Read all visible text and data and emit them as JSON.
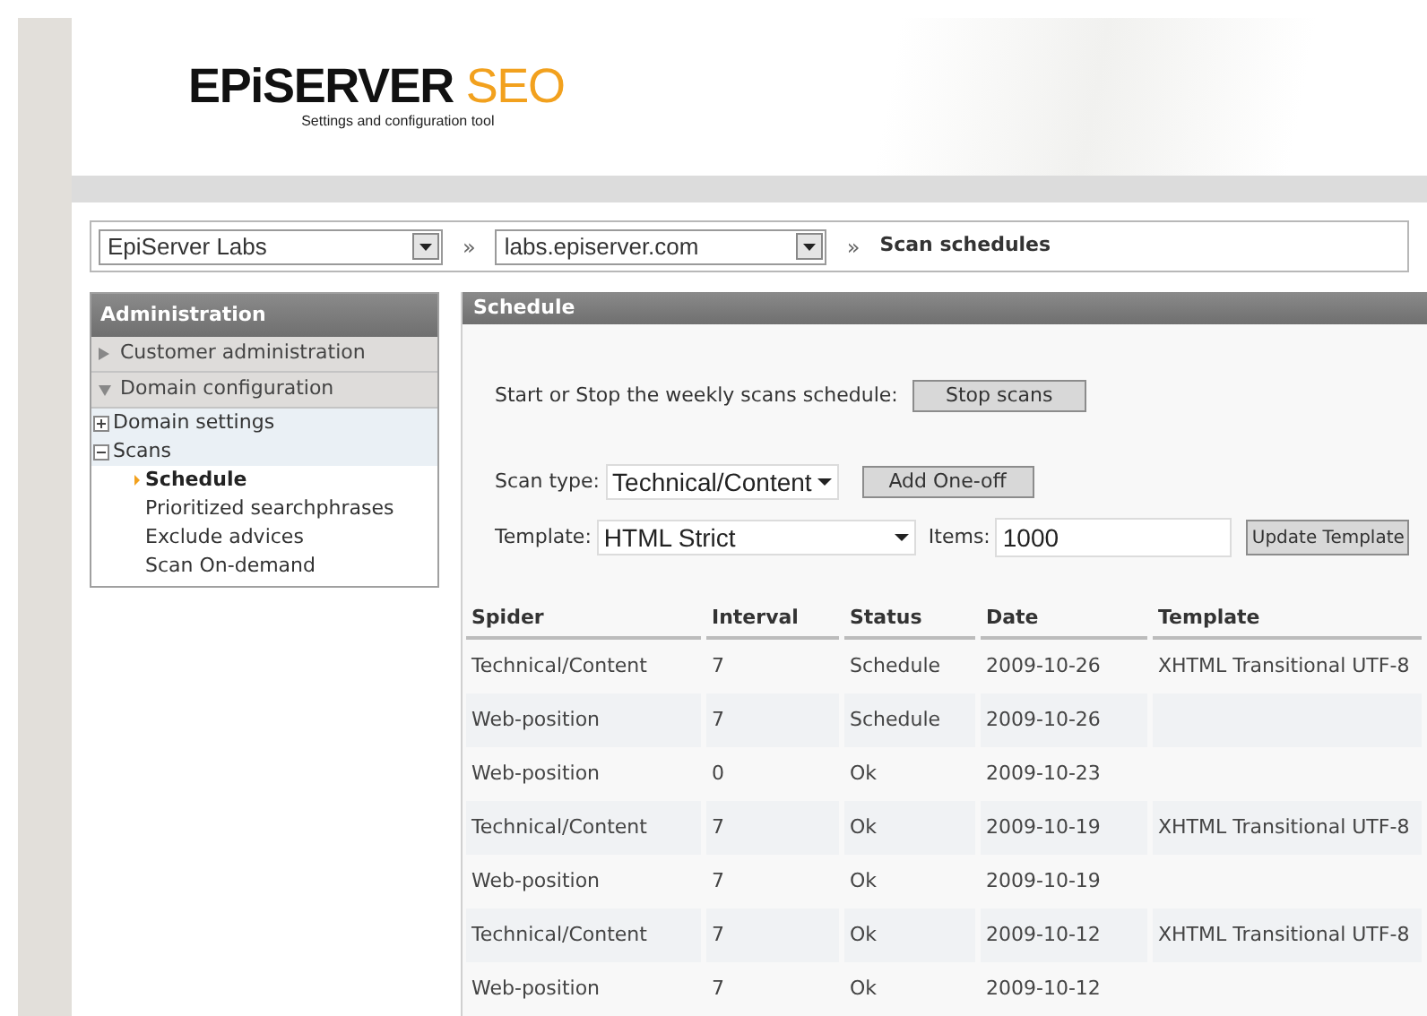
{
  "header": {
    "logo_main": "EPiSERVER",
    "logo_accent": "SEO",
    "tagline": "Settings and configuration tool"
  },
  "breadcrumb": [
    {
      "kind": "select",
      "value": "EpiServer Labs"
    },
    {
      "kind": "separator",
      "text": "»"
    },
    {
      "kind": "select",
      "value": "labs.episerver.com"
    },
    {
      "kind": "separator",
      "text": "»"
    },
    {
      "kind": "current",
      "text": "Scan schedules"
    }
  ],
  "sidebar": {
    "title": "Administration",
    "items": [
      {
        "label": "Customer administration",
        "expanded": false
      },
      {
        "label": "Domain configuration",
        "expanded": true,
        "children": [
          {
            "label": "Domain settings",
            "expanded": false
          },
          {
            "label": "Scans",
            "expanded": true,
            "children": [
              {
                "label": "Schedule",
                "selected": true
              },
              {
                "label": "Prioritized searchphrases",
                "selected": false
              },
              {
                "label": "Exclude advices",
                "selected": false
              },
              {
                "label": "Scan On-demand",
                "selected": false
              }
            ]
          }
        ]
      }
    ]
  },
  "panel": {
    "title": "Schedule",
    "toggle": {
      "label": "Start or Stop the weekly scans schedule:",
      "button": "Stop scans"
    },
    "scan_type": {
      "label": "Scan type:",
      "value": "Technical/Content",
      "button": "Add One-off"
    },
    "template": {
      "label": "Template:",
      "value": "HTML Strict",
      "items_label": "Items:",
      "items_value": "1000",
      "button": "Update Template"
    },
    "table": {
      "columns": [
        "Spider",
        "Interval",
        "Status",
        "Date",
        "Template"
      ],
      "rows": [
        [
          "Technical/Content",
          "7",
          "Schedule",
          "2009-10-26",
          "XHTML Transitional UTF-8"
        ],
        [
          "Web-position",
          "7",
          "Schedule",
          "2009-10-26",
          ""
        ],
        [
          "Web-position",
          "0",
          "Ok",
          "2009-10-23",
          ""
        ],
        [
          "Technical/Content",
          "7",
          "Ok",
          "2009-10-19",
          "XHTML Transitional UTF-8"
        ],
        [
          "Web-position",
          "7",
          "Ok",
          "2009-10-19",
          ""
        ],
        [
          "Technical/Content",
          "7",
          "Ok",
          "2009-10-12",
          "XHTML Transitional UTF-8"
        ],
        [
          "Web-position",
          "7",
          "Ok",
          "2009-10-12",
          ""
        ]
      ]
    }
  }
}
